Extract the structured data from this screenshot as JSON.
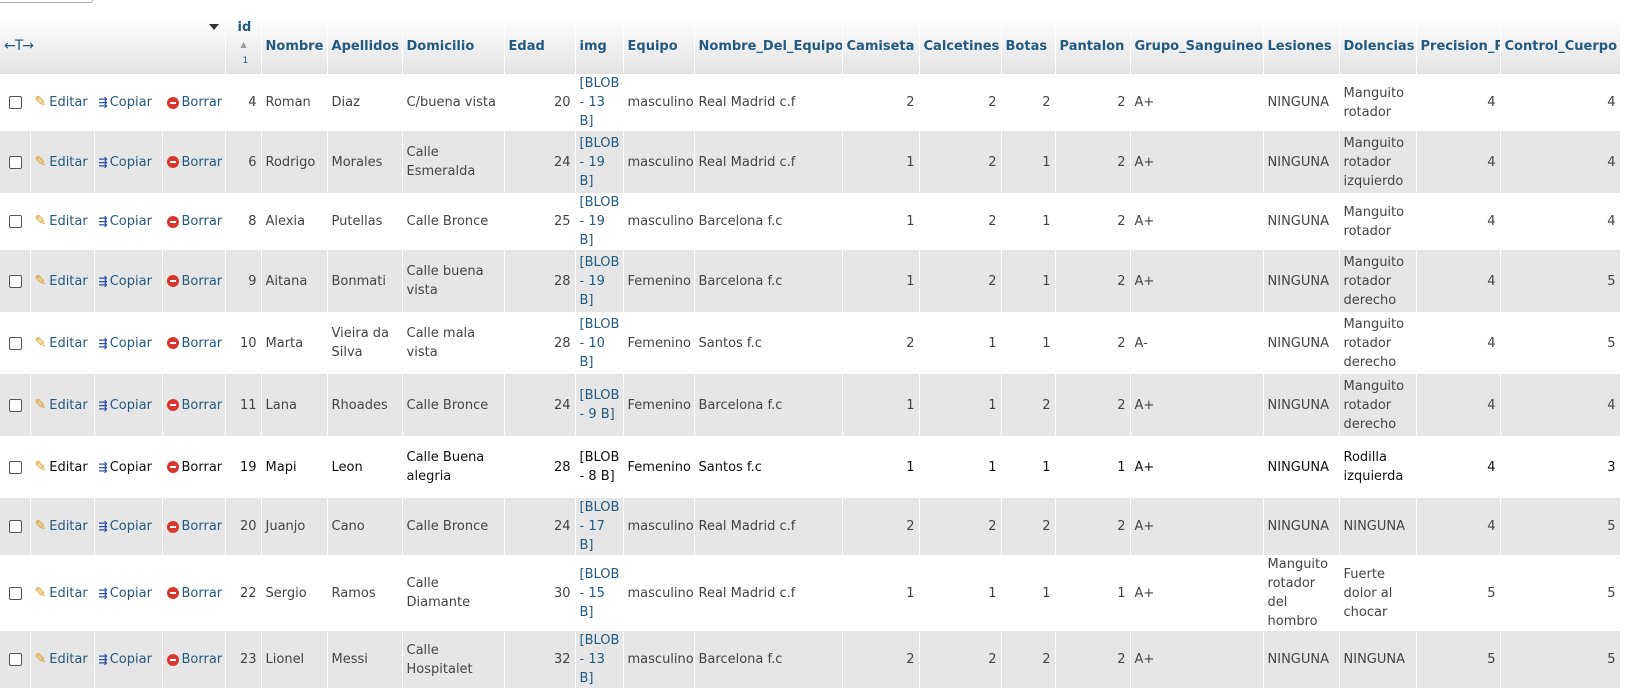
{
  "toolbar": {
    "resize_arrows": "←T→"
  },
  "headers": {
    "id": "id",
    "id_sort_order": "1",
    "columns": [
      "Nombre",
      "Apellidos",
      "Domicilio",
      "Edad",
      "img",
      "Equipo",
      "Nombre_Del_Equipo",
      "Camiseta",
      "Calcetines",
      "Botas",
      "Pantalon",
      "Grupo_Sanguineo",
      "Lesiones",
      "Dolencias",
      "Precision_Pases",
      "Control_Cuerpo"
    ]
  },
  "actions": {
    "edit": "Editar",
    "copy": "Copiar",
    "delete": "Borrar"
  },
  "icons": {
    "edit": "pencil-icon",
    "copy": "copy-icon",
    "delete": "delete-icon",
    "sort": "sort-asc-icon",
    "column-menu": "dropdown-caret-icon"
  },
  "colors": {
    "link": "#235a81",
    "row_even": "#e6e6e6",
    "row_odd": "#ffffff",
    "delete_icon": "#d9372d",
    "pencil_icon": "#d99a17"
  },
  "rows": [
    [
      "4",
      "Roman",
      "Diaz",
      "C/buena vista",
      "20",
      "[BLOB - 13 B]",
      "masculino",
      "Real Madrid c.f",
      "2",
      "2",
      "2",
      "2",
      "A+",
      "NINGUNA",
      "Manguito rotador",
      "4",
      "4"
    ],
    [
      "6",
      "Rodrigo",
      "Morales",
      "Calle Esmeralda",
      "24",
      "[BLOB - 19 B]",
      "masculino",
      "Real Madrid c.f",
      "1",
      "2",
      "1",
      "2",
      "A+",
      "NINGUNA",
      "Manguito rotador izquierdo",
      "4",
      "4"
    ],
    [
      "8",
      "Alexia",
      "Putellas",
      "Calle Bronce",
      "25",
      "[BLOB - 19 B]",
      "masculino",
      "Barcelona f.c",
      "1",
      "2",
      "1",
      "2",
      "A+",
      "NINGUNA",
      "Manguito rotador",
      "4",
      "4"
    ],
    [
      "9",
      "Aitana",
      "Bonmati",
      "Calle buena vista",
      "28",
      "[BLOB - 19 B]",
      "Femenino",
      "Barcelona f.c",
      "1",
      "2",
      "1",
      "2",
      "A+",
      "NINGUNA",
      "Manguito rotador derecho",
      "4",
      "5"
    ],
    [
      "10",
      "Marta",
      "Vieira da Silva",
      "Calle mala vista",
      "28",
      "[BLOB - 10 B]",
      "Femenino",
      "Santos f.c",
      "2",
      "1",
      "1",
      "2",
      "A-",
      "NINGUNA",
      "Manguito rotador derecho",
      "4",
      "5"
    ],
    [
      "11",
      "Lana",
      "Rhoades",
      "Calle Bronce",
      "24",
      "[BLOB - 9 B]",
      "Femenino",
      "Barcelona f.c",
      "1",
      "1",
      "2",
      "2",
      "A+",
      "NINGUNA",
      "Manguito rotador derecho",
      "4",
      "4"
    ],
    [
      "19",
      "Mapi",
      "Leon",
      "Calle Buena alegria",
      "28",
      "[BLOB - 8 B]",
      "Femenino",
      "Santos f.c",
      "1",
      "1",
      "1",
      "1",
      "A+",
      "NINGUNA",
      "Rodilla izquierda",
      "4",
      "3"
    ],
    [
      "20",
      "Juanjo",
      "Cano",
      "Calle Bronce",
      "24",
      "[BLOB - 17 B]",
      "masculino",
      "Real Madrid c.f",
      "2",
      "2",
      "2",
      "2",
      "A+",
      "NINGUNA",
      "NINGUNA",
      "4",
      "5"
    ],
    [
      "22",
      "Sergio",
      "Ramos",
      "Calle Diamante",
      "30",
      "[BLOB - 15 B]",
      "masculino",
      "Real Madrid c.f",
      "1",
      "1",
      "1",
      "1",
      "A+",
      "Manguito rotador del hombro",
      "Fuerte dolor al chocar",
      "5",
      "5"
    ],
    [
      "23",
      "Lionel",
      "Messi",
      "Calle Hospitalet",
      "32",
      "[BLOB - 13 B]",
      "masculino",
      "Barcelona f.c",
      "2",
      "2",
      "2",
      "2",
      "A+",
      "NINGUNA",
      "NINGUNA",
      "5",
      "5"
    ]
  ]
}
